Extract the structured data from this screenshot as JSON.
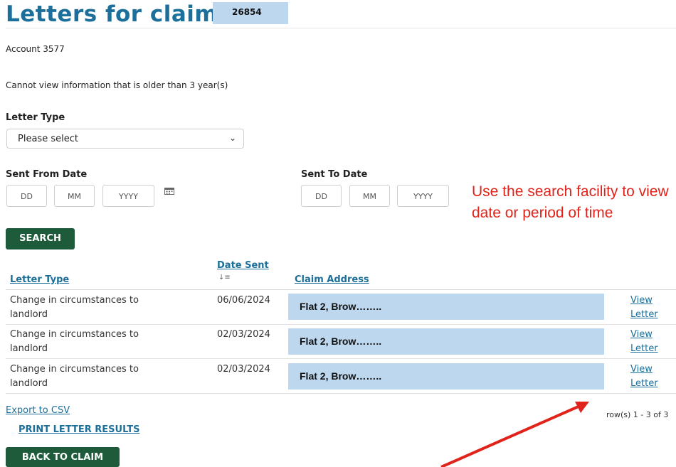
{
  "header": {
    "title": "Letters for claim",
    "claim_ref": "26854"
  },
  "account": "Account 3577",
  "notice": "Cannot view information that is older than 3 year(s)",
  "filter": {
    "letter_type_label": "Letter Type",
    "letter_type_value": "Please select",
    "sent_from_label": "Sent From Date",
    "sent_to_label": "Sent To Date",
    "day_placeholder": "DD",
    "month_placeholder": "MM",
    "year_placeholder": "YYYY",
    "search_label": "SEARCH"
  },
  "annotation": {
    "line1": "Use the search facility to view",
    "line2": "date or period of time"
  },
  "table": {
    "headers": {
      "letter_type": "Letter Type",
      "date_sent": "Date Sent",
      "claim_address": "Claim Address"
    },
    "rows": [
      {
        "letter_type_line1": "Change in circumstances to",
        "letter_type_line2": "landlord",
        "date": "06/06/2024",
        "address": "Flat 2, Brow……..",
        "view1": "View",
        "view2": "Letter"
      },
      {
        "letter_type_line1": "Change in circumstances to",
        "letter_type_line2": "landlord",
        "date": "02/03/2024",
        "address": "Flat 2, Brow……..",
        "view1": "View",
        "view2": "Letter"
      },
      {
        "letter_type_line1": "Change in circumstances to",
        "letter_type_line2": "landlord",
        "date": "02/03/2024",
        "address": "Flat 2, Brow……..",
        "view1": "View",
        "view2": "Letter"
      }
    ]
  },
  "footer": {
    "export_label": "Export to CSV",
    "row_count": "row(s) 1 - 3 of 3",
    "print_label": "PRINT LETTER RESULTS",
    "back_label": "BACK TO CLAIM"
  },
  "colors": {
    "brand_blue": "#1b6f9a",
    "button_green": "#1d5b3b",
    "highlight_blue": "#bcd7ee",
    "annotation_red": "#e0231b"
  },
  "icons": {
    "calendar": "calendar-icon",
    "sort": "sort-icon",
    "dropdown": "chevron-down-icon",
    "arrow": "red-arrow-icon"
  }
}
